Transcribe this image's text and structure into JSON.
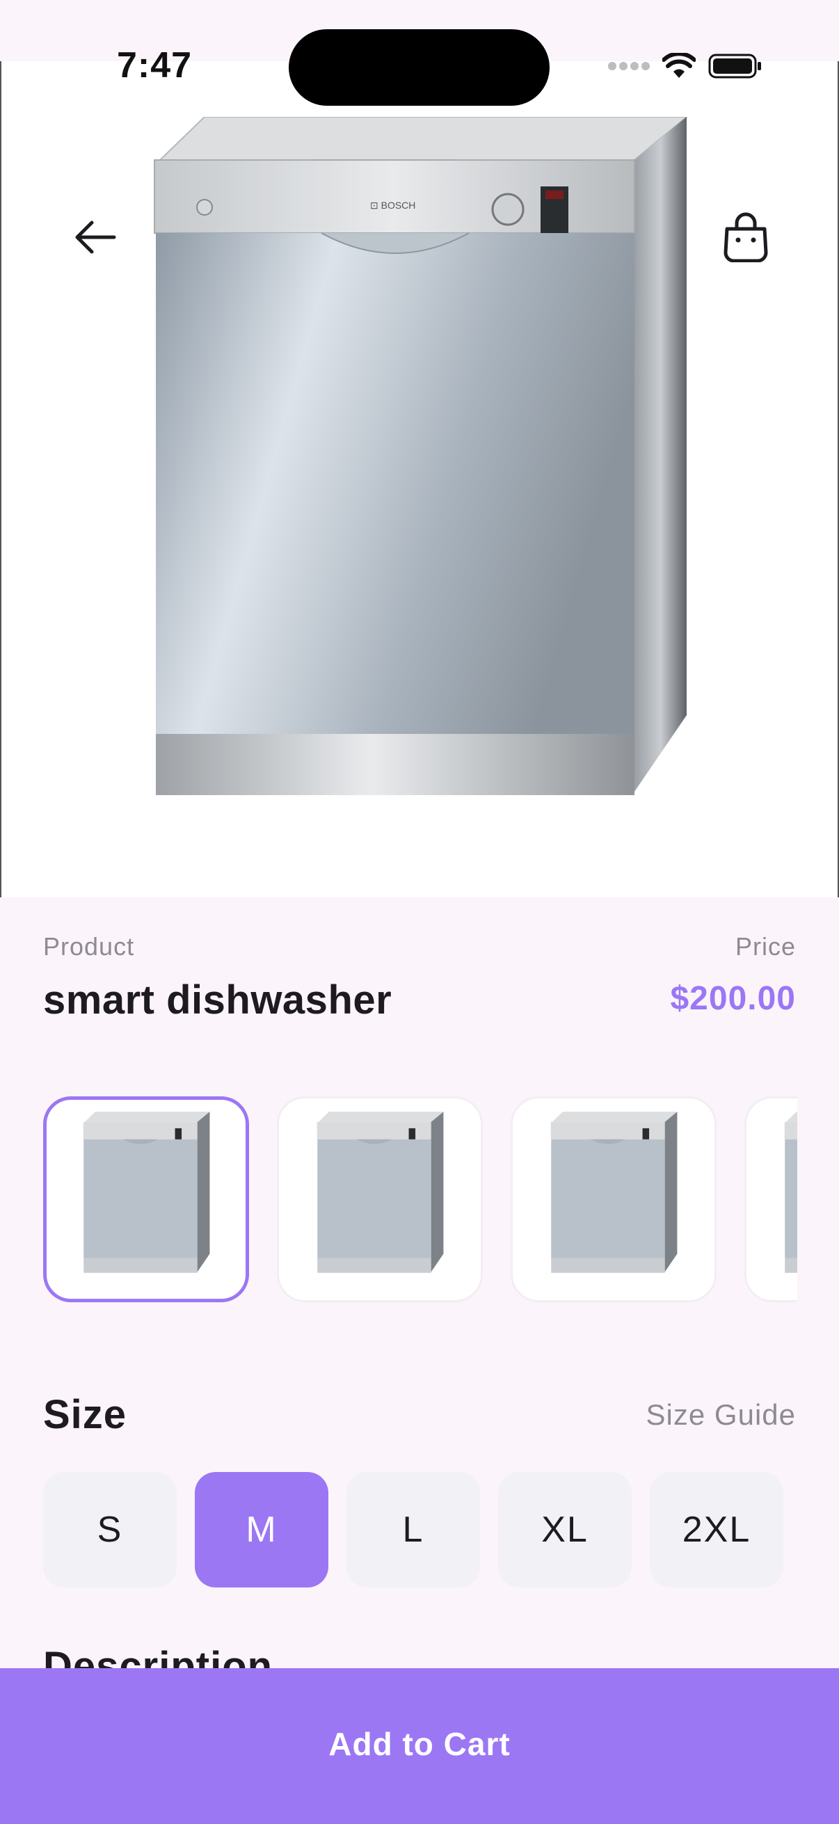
{
  "status_bar": {
    "time": "7:47"
  },
  "header": {
    "back_icon": "arrow-left-icon",
    "bag_icon": "shopping-bag-icon"
  },
  "product": {
    "label": "Product",
    "name": "smart dishwasher",
    "price_label": "Price",
    "price": "$200.00"
  },
  "thumbnails": {
    "count_visible": 4,
    "selected_index": 0
  },
  "size_section": {
    "title": "Size",
    "guide_label": "Size Guide",
    "options": [
      "S",
      "M",
      "L",
      "XL",
      "2XL"
    ],
    "selected": "M"
  },
  "description": {
    "title": "Description"
  },
  "cart": {
    "label": "Add to Cart"
  },
  "colors": {
    "accent": "#9b77f4",
    "background": "#fcf4fb",
    "muted_text": "#8e8a93"
  }
}
